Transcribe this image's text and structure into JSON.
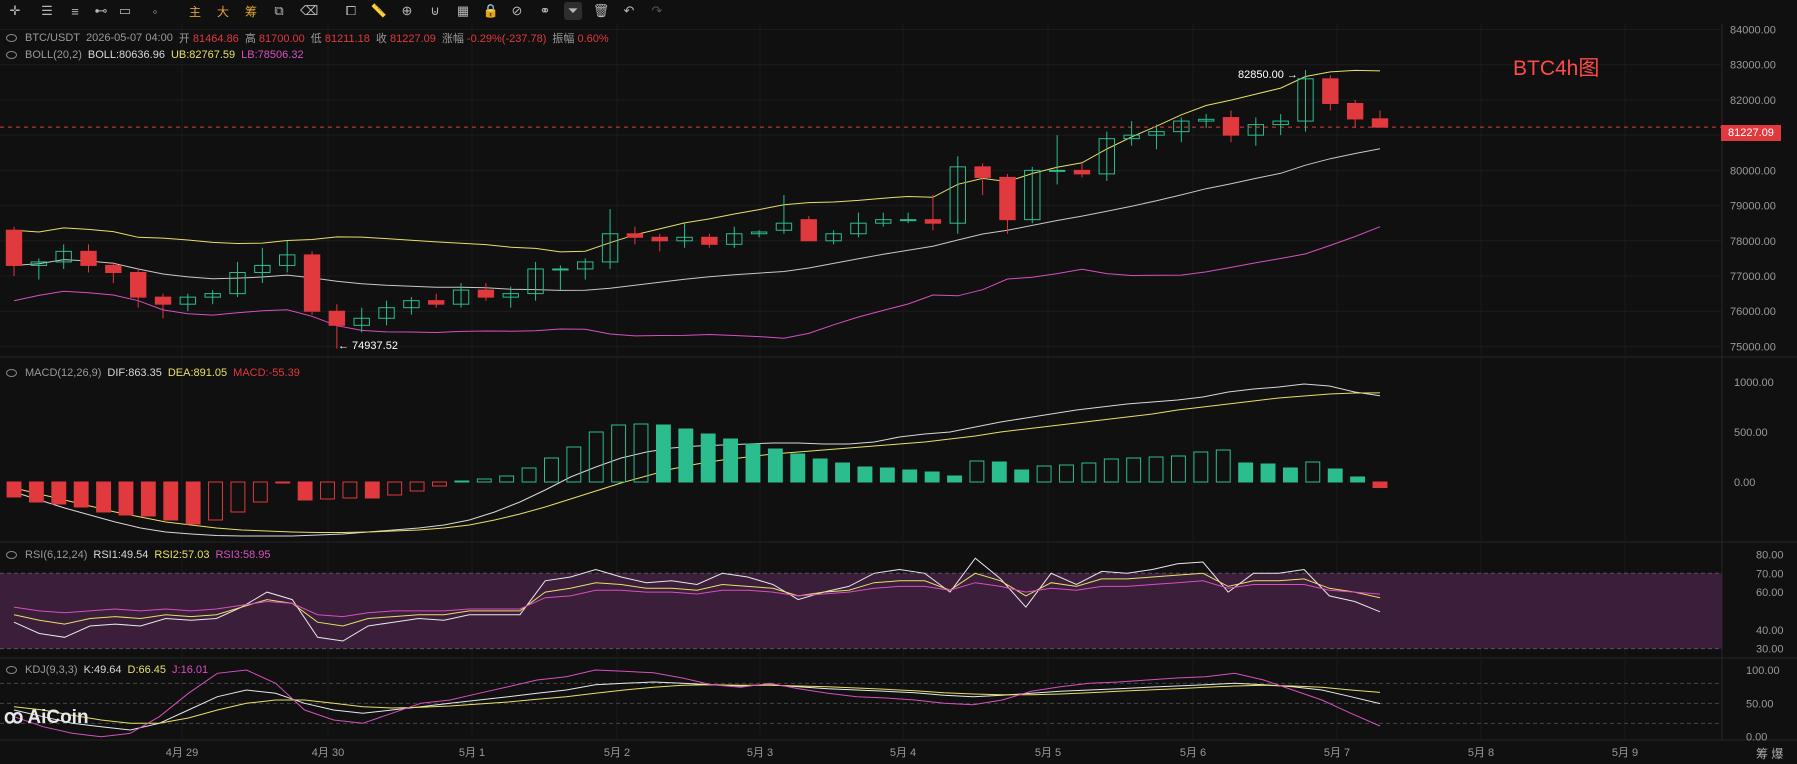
{
  "toolbar": {
    "icons": [
      "crosshair-icon",
      "horizontal-line-icon",
      "parallel-lines-icon",
      "ray-line-icon",
      "rectangle-icon",
      "brush-icon"
    ],
    "text_buttons": [
      "主",
      "大",
      "筹"
    ],
    "tools": [
      "crop-icon",
      "eraser-icon",
      "layers-icon",
      "ruler-icon",
      "magnet-icon",
      "zoom-icon",
      "grid-icon",
      "lock-icon",
      "eye-off-icon",
      "link-icon",
      "filter-icon",
      "trash-icon",
      "undo-icon",
      "redo-icon"
    ]
  },
  "ohlc_bar": {
    "symbol": "BTC/USDT",
    "datetime": "2026-05-07 04:00",
    "open_label": "开",
    "open": "81464.86",
    "high_label": "高",
    "high": "81700.00",
    "low_label": "低",
    "low": "81211.18",
    "close_label": "收",
    "close": "81227.09",
    "change_label": "涨幅",
    "change": "-0.29%(-237.78)",
    "amplitude_label": "振幅",
    "amplitude": "0.60%"
  },
  "boll": {
    "name": "BOLL(20,2)",
    "mid": "BOLL:80636.96",
    "ub": "UB:82767.59",
    "lb": "LB:78506.32"
  },
  "macd": {
    "name": "MACD(12,26,9)",
    "dif": "DIF:863.35",
    "dea": "DEA:891.05",
    "macd": "MACD:-55.39"
  },
  "rsi": {
    "name": "RSI(6,12,24)",
    "rsi1": "RSI1:49.54",
    "rsi2": "RSI2:57.03",
    "rsi3": "RSI3:58.95"
  },
  "kdj": {
    "name": "KDJ(9,3,3)",
    "k": "K:49.64",
    "d": "D:66.45",
    "j": "J:16.01"
  },
  "annotation": "BTC4h图",
  "price_label": "81227.09",
  "high_mark": "82850.00 →",
  "low_mark": "← 74937.52",
  "logo": "AiCoin",
  "corner": "筹 爆",
  "colors": {
    "up": "#2bbd8e",
    "down": "#e0393e",
    "boll_mid": "#c8c8c8",
    "boll_ub": "#e6e066",
    "boll_lb": "#d84fbf",
    "dif": "#d8d8d8",
    "dea": "#e6e066",
    "rsi1": "#e8e8e8",
    "rsi2": "#e6e066",
    "rsi3": "#d84fbf",
    "rsi_band": "#3a1e3a"
  },
  "chart_data": [
    {
      "type": "candlestick",
      "title": "BTC/USDT 4h",
      "x_ticks": [
        "4月 29",
        "4月 30",
        "5月 1",
        "5月 2",
        "5月 3",
        "5月 4",
        "5月 5",
        "5月 6",
        "5月 7",
        "5月 8",
        "5月 9"
      ],
      "y_ticks": [
        "84000.00",
        "83000.00",
        "82000.00",
        "81000.00",
        "80000.00",
        "79000.00",
        "78000.00",
        "77000.00",
        "76000.00",
        "75000.00"
      ],
      "ylim": [
        74700,
        84100
      ],
      "candles": [
        [
          78300,
          78400,
          77000,
          77300
        ],
        [
          77300,
          77500,
          76900,
          77400
        ],
        [
          77400,
          77900,
          77200,
          77700
        ],
        [
          77700,
          77900,
          77100,
          77300
        ],
        [
          77300,
          77400,
          76800,
          77100
        ],
        [
          77100,
          77200,
          76100,
          76400
        ],
        [
          76400,
          76500,
          75800,
          76200
        ],
        [
          76200,
          76500,
          76000,
          76400
        ],
        [
          76400,
          76600,
          76200,
          76500
        ],
        [
          76500,
          77400,
          76400,
          77100
        ],
        [
          77100,
          77800,
          76800,
          77300
        ],
        [
          77300,
          78000,
          77100,
          77600
        ],
        [
          77600,
          77700,
          75900,
          76000
        ],
        [
          76000,
          76200,
          74937.52,
          75600
        ],
        [
          75600,
          76100,
          75400,
          75800
        ],
        [
          75800,
          76300,
          75600,
          76100
        ],
        [
          76100,
          76400,
          75900,
          76300
        ],
        [
          76300,
          76500,
          76100,
          76200
        ],
        [
          76200,
          76800,
          76100,
          76600
        ],
        [
          76600,
          76800,
          76300,
          76400
        ],
        [
          76400,
          76700,
          76100,
          76500
        ],
        [
          76500,
          77400,
          76300,
          77200
        ],
        [
          77200,
          77300,
          76600,
          77200
        ],
        [
          77200,
          77500,
          76900,
          77400
        ],
        [
          77400,
          78900,
          77200,
          78200
        ],
        [
          78200,
          78400,
          77900,
          78100
        ],
        [
          78100,
          78200,
          77700,
          78000
        ],
        [
          78000,
          78500,
          77800,
          78100
        ],
        [
          78100,
          78200,
          77800,
          77900
        ],
        [
          77900,
          78400,
          77800,
          78200
        ],
        [
          78200,
          78300,
          78100,
          78250
        ],
        [
          78300,
          79300,
          78200,
          78500
        ],
        [
          78600,
          78700,
          78000,
          78000
        ],
        [
          78000,
          78300,
          77900,
          78200
        ],
        [
          78200,
          78800,
          78100,
          78500
        ],
        [
          78500,
          78800,
          78400,
          78600
        ],
        [
          78600,
          78800,
          78500,
          78600
        ],
        [
          78600,
          79300,
          78300,
          78500
        ],
        [
          78500,
          80400,
          78200,
          80100
        ],
        [
          80100,
          80200,
          79300,
          79800
        ],
        [
          79800,
          79900,
          78200,
          78600
        ],
        [
          78600,
          80100,
          78500,
          80000
        ],
        [
          80000,
          81000,
          79600,
          80000
        ],
        [
          80000,
          80200,
          79800,
          79900
        ],
        [
          79900,
          81100,
          79700,
          80900
        ],
        [
          80900,
          81400,
          80700,
          81000
        ],
        [
          81000,
          81300,
          80600,
          81100
        ],
        [
          81100,
          81500,
          80800,
          81400
        ],
        [
          81400,
          81600,
          81200,
          81450
        ],
        [
          81500,
          81700,
          80800,
          81000
        ],
        [
          81000,
          81500,
          80700,
          81300
        ],
        [
          81300,
          81600,
          81000,
          81400
        ],
        [
          81400,
          82850,
          81100,
          82600
        ],
        [
          82600,
          82700,
          81700,
          81900
        ],
        [
          81900,
          82000,
          81200,
          81460
        ],
        [
          81464.86,
          81700,
          81211.18,
          81227.09
        ]
      ]
    },
    {
      "type": "bar",
      "title": "MACD(12,26,9)",
      "y_ticks": [
        "1000.00",
        "500.00",
        "0.00"
      ],
      "ylim": [
        -600,
        1200
      ],
      "values": [
        -150,
        -200,
        -220,
        -250,
        -300,
        -330,
        -340,
        -380,
        -420,
        -380,
        -300,
        -200,
        -10,
        -180,
        -170,
        -160,
        -160,
        -130,
        -90,
        -40,
        10,
        30,
        60,
        140,
        240,
        350,
        500,
        570,
        580,
        570,
        530,
        480,
        430,
        380,
        330,
        280,
        230,
        190,
        150,
        140,
        120,
        100,
        60,
        210,
        200,
        120,
        160,
        170,
        190,
        230,
        240,
        250,
        260,
        300,
        320,
        190,
        180,
        140,
        200,
        130,
        50,
        -55.39
      ],
      "dif": [
        -100,
        -180,
        -260,
        -330,
        -400,
        -460,
        -500,
        -520,
        -535,
        -540,
        -540,
        -540,
        -530,
        -520,
        -500,
        -480,
        -460,
        -430,
        -380,
        -300,
        -200,
        -80,
        50,
        150,
        240,
        300,
        340,
        360,
        370,
        380,
        390,
        390,
        380,
        380,
        400,
        450,
        480,
        500,
        550,
        600,
        640,
        680,
        720,
        750,
        780,
        800,
        820,
        850,
        900,
        930,
        950,
        980,
        960,
        900,
        863.35
      ],
      "dea": [
        -60,
        -120,
        -180,
        -240,
        -300,
        -350,
        -400,
        -430,
        -460,
        -480,
        -490,
        -500,
        -505,
        -505,
        -500,
        -490,
        -480,
        -460,
        -430,
        -380,
        -320,
        -250,
        -170,
        -90,
        -10,
        60,
        130,
        180,
        220,
        250,
        280,
        300,
        320,
        340,
        360,
        380,
        400,
        430,
        460,
        500,
        530,
        560,
        590,
        620,
        650,
        680,
        720,
        750,
        780,
        810,
        840,
        860,
        880,
        890,
        891.05
      ]
    },
    {
      "type": "line",
      "title": "RSI(6,12,24)",
      "y_ticks": [
        "80.00",
        "70.00",
        "60.00",
        "40.00",
        "30.00"
      ],
      "ylim": [
        25,
        85
      ],
      "series": [
        {
          "name": "RSI1",
          "values": [
            44,
            38,
            36,
            42,
            43,
            42,
            46,
            45,
            46,
            52,
            60,
            56,
            36,
            34,
            42,
            44,
            46,
            45,
            48,
            48,
            48,
            66,
            68,
            72,
            68,
            65,
            66,
            64,
            70,
            68,
            64,
            56,
            60,
            63,
            70,
            72,
            70,
            60,
            78,
            67,
            52,
            70,
            64,
            71,
            70,
            72,
            75,
            76,
            60,
            70,
            70,
            72,
            58,
            55,
            49.54
          ]
        },
        {
          "name": "RSI2",
          "values": [
            48,
            45,
            43,
            46,
            47,
            46,
            48,
            47,
            48,
            52,
            56,
            54,
            44,
            42,
            46,
            47,
            48,
            48,
            50,
            50,
            50,
            60,
            62,
            65,
            64,
            62,
            62,
            61,
            64,
            63,
            62,
            58,
            60,
            61,
            65,
            66,
            66,
            61,
            70,
            66,
            58,
            65,
            63,
            67,
            67,
            68,
            69,
            70,
            63,
            66,
            66,
            67,
            62,
            60,
            57.03
          ]
        },
        {
          "name": "RSI3",
          "values": [
            52,
            50,
            49,
            50,
            51,
            50,
            51,
            50,
            51,
            53,
            55,
            54,
            48,
            47,
            49,
            50,
            50,
            50,
            51,
            51,
            51,
            57,
            58,
            61,
            61,
            60,
            60,
            59,
            61,
            61,
            60,
            58,
            59,
            60,
            62,
            63,
            63,
            61,
            65,
            63,
            60,
            62,
            61,
            63,
            63,
            64,
            65,
            66,
            62,
            64,
            64,
            64,
            61,
            60,
            58.95
          ]
        }
      ]
    },
    {
      "type": "line",
      "title": "KDJ(9,3,3)",
      "y_ticks": [
        "100.00",
        "50.00",
        "0.00"
      ],
      "ylim": [
        -5,
        115
      ],
      "series": [
        {
          "name": "K",
          "values": [
            40,
            30,
            20,
            15,
            10,
            20,
            40,
            60,
            70,
            65,
            50,
            40,
            35,
            40,
            45,
            50,
            55,
            60,
            65,
            70,
            78,
            80,
            82,
            80,
            78,
            76,
            78,
            75,
            72,
            70,
            68,
            66,
            62,
            60,
            62,
            65,
            68,
            70,
            72,
            74,
            76,
            78,
            80,
            78,
            75,
            70,
            60,
            49.64
          ]
        },
        {
          "name": "D",
          "values": [
            45,
            40,
            32,
            25,
            20,
            20,
            28,
            40,
            50,
            55,
            55,
            50,
            45,
            43,
            44,
            46,
            49,
            52,
            56,
            60,
            65,
            70,
            74,
            77,
            78,
            77,
            77,
            76,
            75,
            73,
            71,
            69,
            66,
            64,
            63,
            63,
            64,
            66,
            68,
            70,
            72,
            74,
            76,
            77,
            76,
            74,
            70,
            66.45
          ]
        },
        {
          "name": "J",
          "values": [
            30,
            15,
            5,
            0,
            5,
            30,
            65,
            95,
            100,
            80,
            40,
            25,
            20,
            35,
            50,
            55,
            65,
            75,
            85,
            90,
            100,
            98,
            96,
            88,
            78,
            74,
            80,
            72,
            65,
            60,
            58,
            55,
            50,
            48,
            55,
            68,
            75,
            80,
            82,
            85,
            88,
            90,
            95,
            85,
            70,
            55,
            35,
            16.01
          ]
        }
      ]
    }
  ]
}
